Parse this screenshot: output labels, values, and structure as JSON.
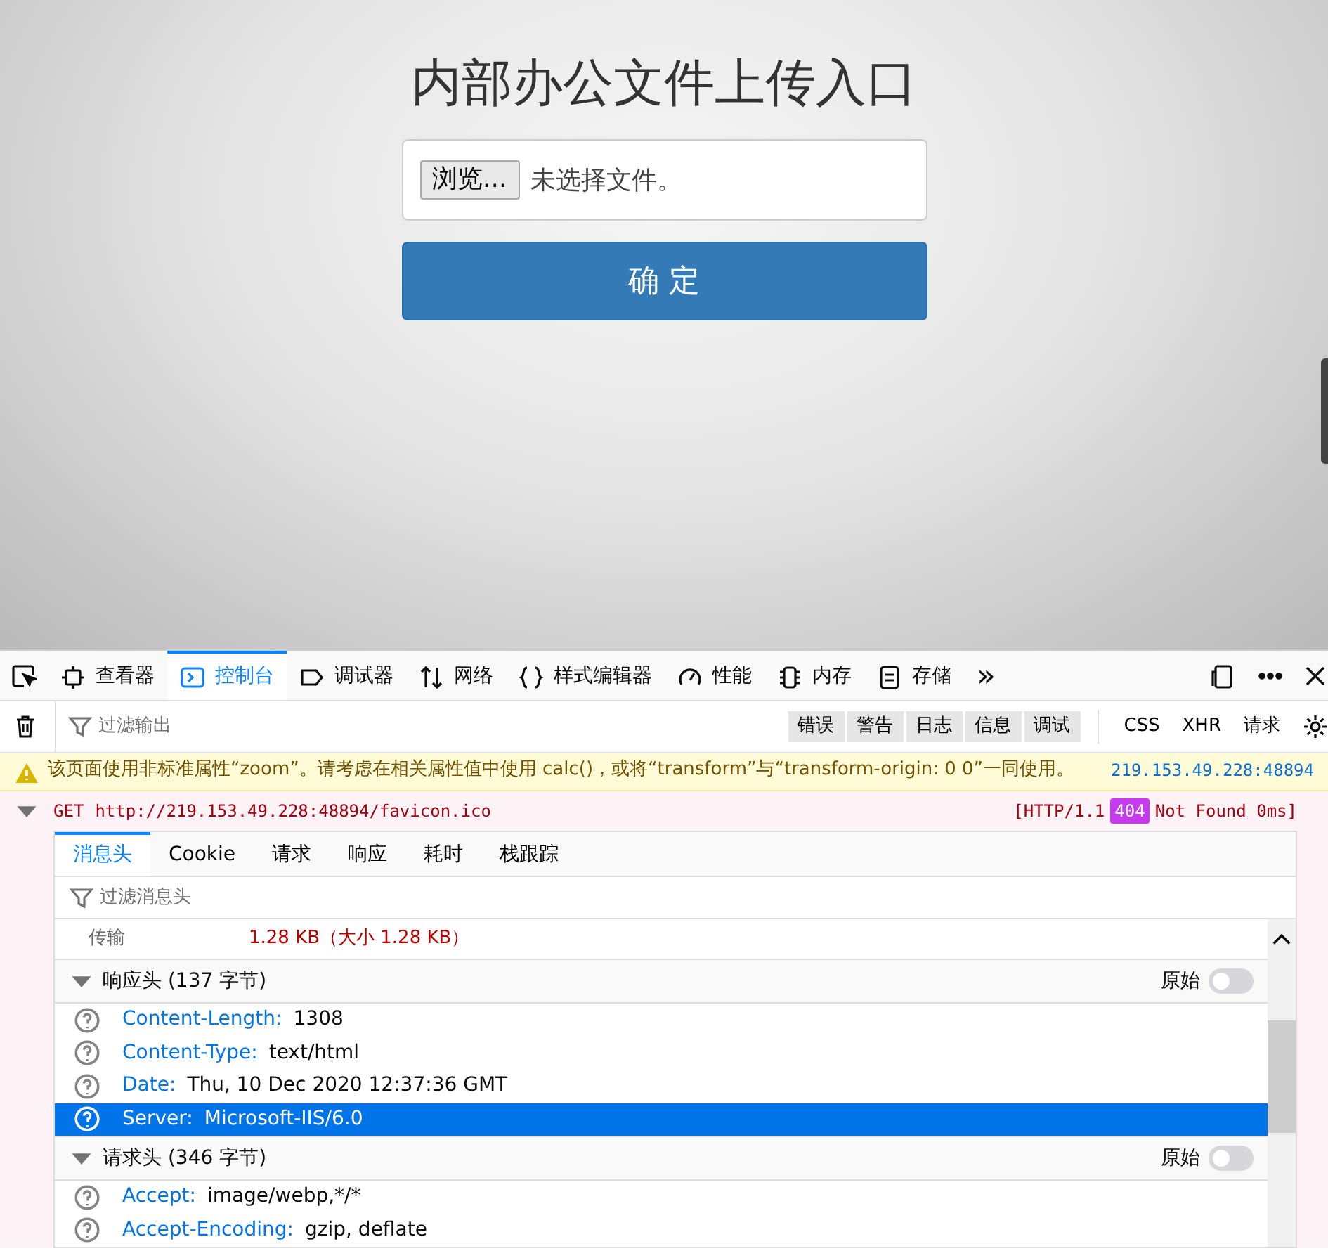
{
  "page": {
    "title": "内部办公文件上传入口",
    "file_input": {
      "button": "浏览...",
      "status": "未选择文件。"
    },
    "submit_button": "确 定"
  },
  "devtools": {
    "tabs": [
      {
        "label": "查看器",
        "selected": false
      },
      {
        "label": "控制台",
        "selected": true
      },
      {
        "label": "调试器",
        "selected": false
      },
      {
        "label": "网络",
        "selected": false
      },
      {
        "label": "样式编辑器",
        "selected": false
      },
      {
        "label": "性能",
        "selected": false
      },
      {
        "label": "内存",
        "selected": false
      },
      {
        "label": "存储",
        "selected": false
      }
    ],
    "more": "»",
    "filter": {
      "placeholder": "过滤输出"
    },
    "level_filters": [
      "错误",
      "警告",
      "日志",
      "信息",
      "调试"
    ],
    "type_filters": [
      "CSS",
      "XHR",
      "请求"
    ],
    "warning": {
      "text": "该页面使用非标准属性“zoom”。请考虑在相关属性值中使用 calc()，或将“transform”与“transform-origin: 0 0”一同使用。",
      "source": "219.153.49.228:48894"
    },
    "request": {
      "expanded": true,
      "method": "GET",
      "url": "http://219.153.49.228:48894/favicon.ico",
      "status_prefix": "[HTTP/1.1",
      "status_code": "404",
      "status_suffix": "Not Found 0ms]"
    },
    "detail_tabs": [
      {
        "label": "消息头",
        "selected": true
      },
      {
        "label": "Cookie",
        "selected": false
      },
      {
        "label": "请求",
        "selected": false
      },
      {
        "label": "响应",
        "selected": false
      },
      {
        "label": "耗时",
        "selected": false
      },
      {
        "label": "栈跟踪",
        "selected": false
      }
    ],
    "detail_filter": {
      "placeholder": "过滤消息头"
    },
    "transfer": {
      "label": "传输",
      "value": "1.28 KB（大小 1.28 KB）"
    },
    "sections": [
      {
        "title": "响应头 (137 字节)",
        "raw_label": "原始",
        "raw_on": false,
        "headers": [
          {
            "name": "Content-Length:",
            "value": "1308",
            "selected": false
          },
          {
            "name": "Content-Type:",
            "value": "text/html",
            "selected": false
          },
          {
            "name": "Date:",
            "value": "Thu, 10 Dec 2020 12:37:36 GMT",
            "selected": false
          },
          {
            "name": "Server:",
            "value": "Microsoft-IIS/6.0",
            "selected": true
          }
        ]
      },
      {
        "title": "请求头 (346 字节)",
        "raw_label": "原始",
        "raw_on": false,
        "headers": [
          {
            "name": "Accept:",
            "value": "image/webp,*/*",
            "selected": false
          },
          {
            "name": "Accept-Encoding:",
            "value": "gzip, deflate",
            "selected": false
          }
        ]
      }
    ]
  }
}
